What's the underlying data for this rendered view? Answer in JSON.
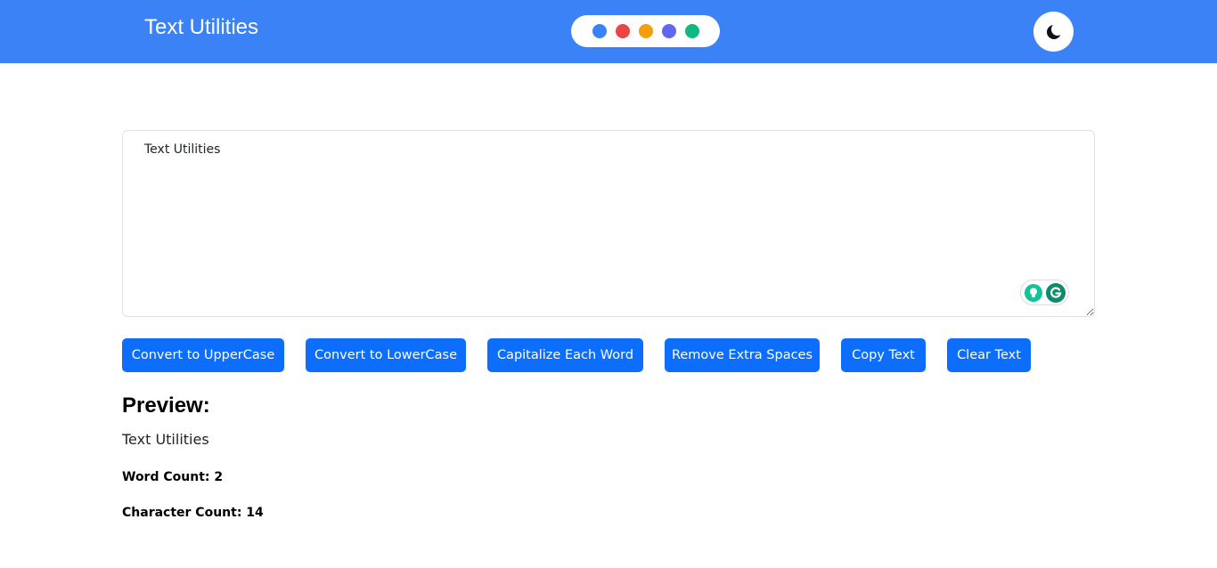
{
  "navbar": {
    "brand": "Text Utilities",
    "theme_colors": [
      "#3b82f6",
      "#ef4444",
      "#f59e0b",
      "#6366f1",
      "#10b981"
    ],
    "mode_toggle_icon": "moon-icon"
  },
  "editor": {
    "value": "Text Utilities",
    "widget_icons": [
      "bulb-icon",
      "grammarly-icon"
    ]
  },
  "actions": {
    "uppercase": "Convert to UpperCase",
    "lowercase": "Convert to LowerCase",
    "capitalize": "Capitalize Each Word",
    "remove_spaces": "Remove Extra Spaces",
    "copy": "Copy Text",
    "clear": "Clear Text"
  },
  "preview": {
    "title": "Preview:",
    "text": "Text Utilities",
    "word_count": "Word Count: 2",
    "char_count": "Character Count: 14"
  },
  "colors": {
    "navbar_bg": "#3b82f6",
    "button_bg": "#0d6efd"
  }
}
